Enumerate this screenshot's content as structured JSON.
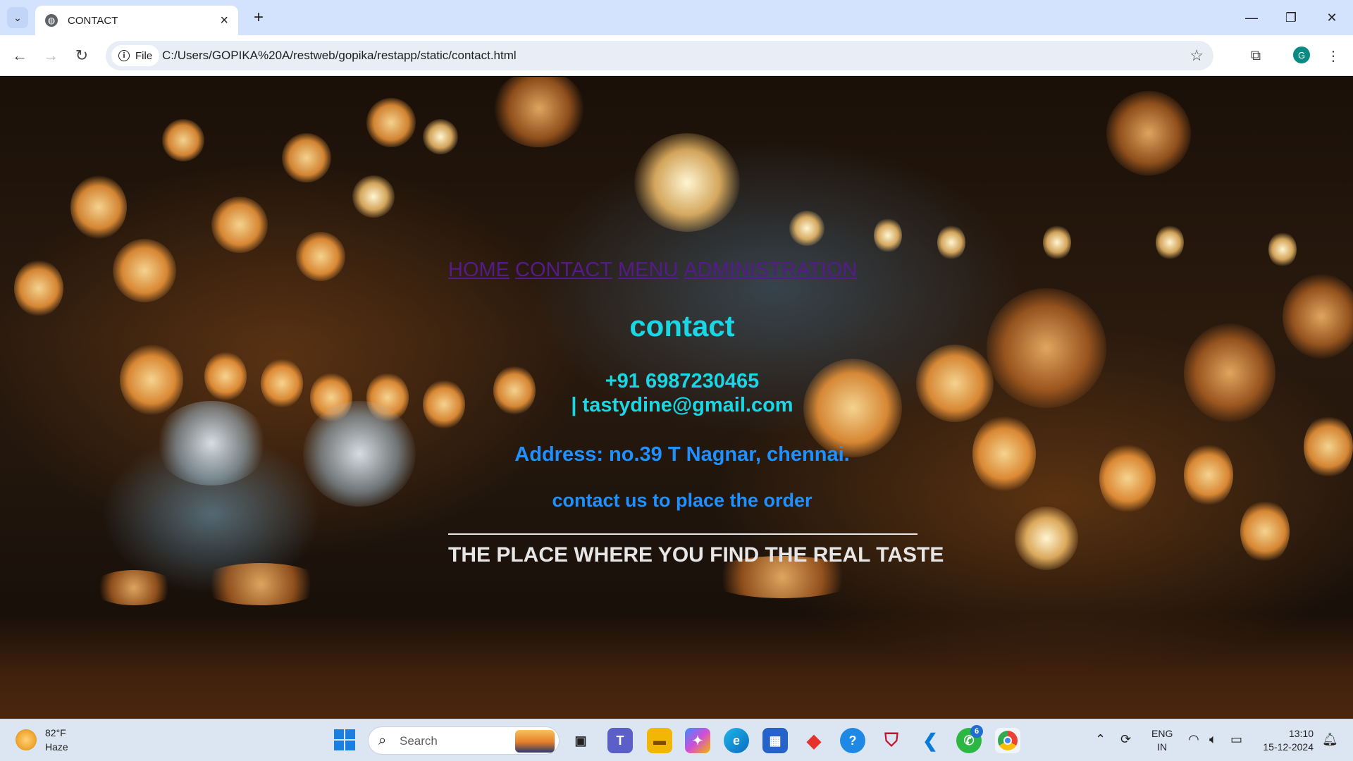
{
  "browser": {
    "tab_title": "CONTACT",
    "url": "C:/Users/GOPIKA%20A/restweb/gopika/restapp/static/contact.html",
    "site_chip_label": "File",
    "profile_initial": "G"
  },
  "page": {
    "nav": {
      "home": "HOME",
      "contact": "CONTACT",
      "menu": "MENU",
      "administration": "ADMINISTRATION"
    },
    "heading": "contact",
    "phone": "+91 6987230465",
    "email": "| tastydine@gmail.com",
    "address": "Address: no.39 T Nagnar, chennai.",
    "order_text": "contact us to place the order",
    "tagline": "THE PLACE WHERE YOU FIND THE REAL TASTE",
    "colors": {
      "heading": "#1ad7e6",
      "address": "#1e90ff",
      "link_visited": "#551a8b",
      "tagline": "#e6e6e6"
    }
  },
  "taskbar": {
    "weather_temp": "82°F",
    "weather_desc": "Haze",
    "search_placeholder": "Search",
    "whatsapp_badge": "6",
    "lang_line1": "ENG",
    "lang_line2": "IN",
    "time": "13:10",
    "date": "15-12-2024"
  }
}
